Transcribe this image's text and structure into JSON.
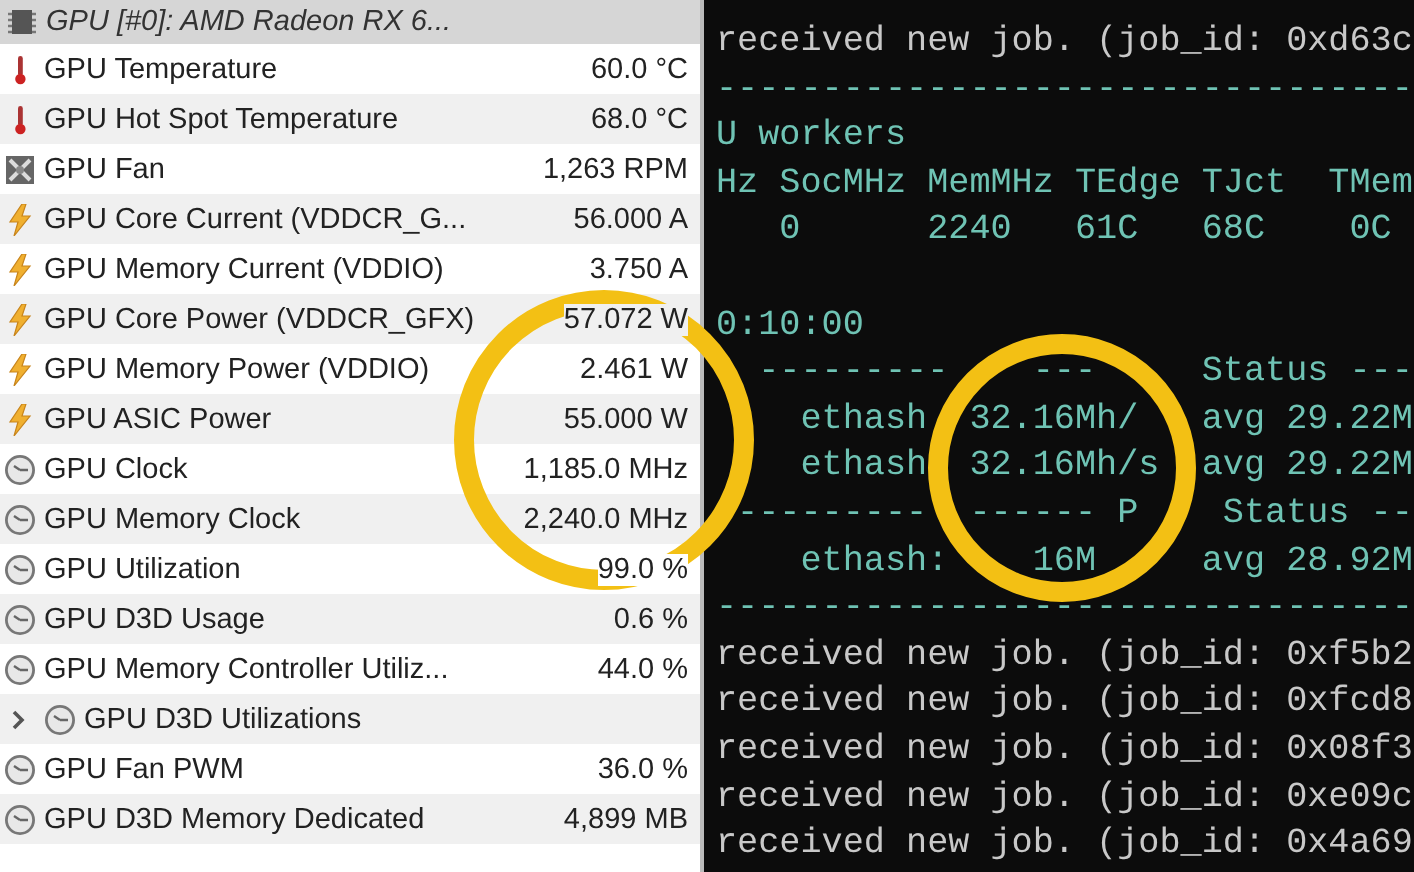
{
  "sensor_panel": {
    "header": "GPU [#0]: AMD Radeon RX 6...",
    "rows": [
      {
        "kind": "temperature",
        "label": "GPU Temperature",
        "value": "60.0 °C"
      },
      {
        "kind": "temperature",
        "label": "GPU Hot Spot Temperature",
        "value": "68.0 °C"
      },
      {
        "kind": "fan",
        "label": "GPU Fan",
        "value": "1,263 RPM"
      },
      {
        "kind": "power",
        "label": "GPU Core Current (VDDCR_G...",
        "value": "56.000 A"
      },
      {
        "kind": "power",
        "label": "GPU Memory Current (VDDIO)",
        "value": "3.750 A"
      },
      {
        "kind": "power",
        "label": "GPU Core Power (VDDCR_GFX)",
        "value": "57.072 W"
      },
      {
        "kind": "power",
        "label": "GPU Memory Power (VDDIO)",
        "value": "2.461 W"
      },
      {
        "kind": "power",
        "label": "GPU ASIC Power",
        "value": "55.000 W"
      },
      {
        "kind": "clock",
        "label": "GPU Clock",
        "value": "1,185.0 MHz"
      },
      {
        "kind": "clock",
        "label": "GPU Memory Clock",
        "value": "2,240.0 MHz"
      },
      {
        "kind": "clock",
        "label": "GPU Utilization",
        "value": "99.0 %"
      },
      {
        "kind": "clock",
        "label": "GPU D3D Usage",
        "value": "0.6 %"
      },
      {
        "kind": "clock",
        "label": "GPU Memory Controller Utiliz...",
        "value": "44.0 %"
      },
      {
        "kind": "group",
        "label": "GPU D3D Utilizations",
        "expanded": false
      },
      {
        "kind": "clock",
        "label": "GPU Fan PWM",
        "value": "36.0 %"
      },
      {
        "kind": "clock",
        "label": "GPU D3D Memory Dedicated",
        "value": "4,899 MB"
      }
    ]
  },
  "terminal": {
    "lines": [
      {
        "kind": "log",
        "text": "received new job. (job_id: 0xd63c"
      },
      {
        "kind": "stat",
        "text": "---------------------------------"
      },
      {
        "kind": "stat",
        "text": "U workers"
      },
      {
        "kind": "stat",
        "text": "Hz SocMHz MemMHz TEdge TJct  TMem"
      },
      {
        "kind": "stat",
        "text": "   0      2240   61C   68C    0C"
      },
      {
        "kind": "blank"
      },
      {
        "kind": "stat",
        "text": "0:10:00"
      },
      {
        "kind": "stat",
        "text": "  ---------    ---     Status ---"
      },
      {
        "kind": "stat",
        "text": "    ethash  32.16Mh/   avg 29.22M"
      },
      {
        "kind": "stat",
        "text": "    ethash  32.16Mh/s  avg 29.22M"
      },
      {
        "kind": "stat",
        "text": " ---------  ------ P    Status --"
      },
      {
        "kind": "stat",
        "text": "    ethash:    16M     avg 28.92M"
      },
      {
        "kind": "stat",
        "text": "---------------------------------"
      },
      {
        "kind": "log",
        "text": "received new job. (job_id: 0xf5b2"
      },
      {
        "kind": "log",
        "text": "received new job. (job_id: 0xfcd8"
      },
      {
        "kind": "log",
        "text": "received new job. (job_id: 0x08f3"
      },
      {
        "kind": "log",
        "text": "received new job. (job_id: 0xe09c"
      },
      {
        "kind": "log",
        "text": "received new job. (job_id: 0x4a69"
      }
    ]
  }
}
